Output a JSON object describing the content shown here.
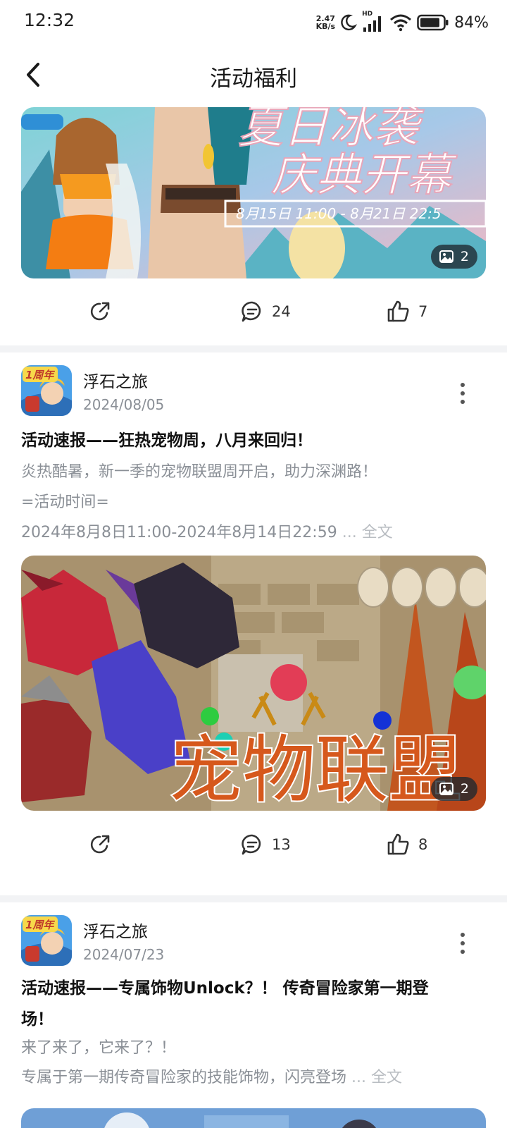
{
  "status_bar": {
    "time": "12:32",
    "net_speed_value": "2.47",
    "net_speed_unit": "KB/s",
    "network_label": "HD",
    "battery": "84%"
  },
  "header": {
    "title": "活动福利"
  },
  "colors": {
    "accent_bg": "#f2f3f5",
    "muted_text": "#8a8f96",
    "badge_bg": "#1e2830"
  },
  "posts": [
    {
      "banner_text_1": "夏日冰袭",
      "banner_text_2": "庆典开幕",
      "banner_date": "8月15日 11:00 - 8月21日 22:5",
      "image_count": "2",
      "comments": "24",
      "likes": "7"
    },
    {
      "avatar_badge": "1周年",
      "author": "浮石之旅",
      "date": "2024/08/05",
      "title": "活动速报——狂热宠物周，八月来回归！",
      "lines": [
        "炎热酷暑，新一季的宠物联盟周开启，助力深渊路！",
        "=活动时间=",
        "2024年8月8日11:00-2024年8月14日22:59"
      ],
      "ellipsis": "...",
      "full_text_label": "全文",
      "banner_text": "宠物联盟",
      "image_count": "2",
      "comments": "13",
      "likes": "8"
    },
    {
      "avatar_badge": "1周年",
      "author": "浮石之旅",
      "date": "2024/07/23",
      "title_line_1": "活动速报——专属饰物Unlock？！ 传奇冒险家第一期登",
      "title_line_2": "场！",
      "lines": [
        "来了来了，它来了？！",
        "专属于第一期传奇冒险家的技能饰物，闪亮登场"
      ],
      "ellipsis": "...",
      "full_text_label": "全文"
    }
  ]
}
